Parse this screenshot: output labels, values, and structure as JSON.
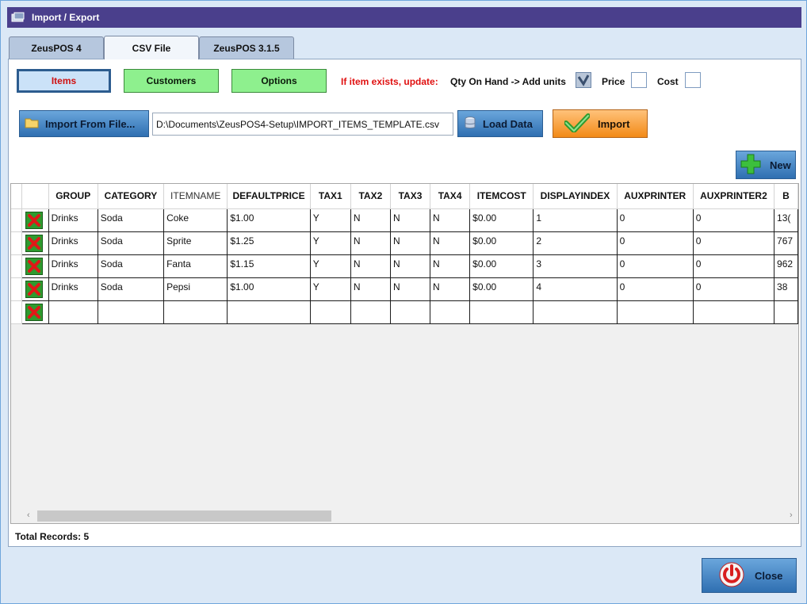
{
  "window": {
    "title": "Import / Export"
  },
  "tabs": [
    {
      "label": "ZeusPOS 4",
      "active": false
    },
    {
      "label": "CSV File",
      "active": true
    },
    {
      "label": "ZeusPOS 3.1.5",
      "active": false
    }
  ],
  "selectors": {
    "items": "Items",
    "customers": "Customers",
    "options": "Options"
  },
  "update_options": {
    "label": "If item exists, update:",
    "qty_label": "Qty On Hand -> Add units",
    "qty_checked": true,
    "price_label": "Price",
    "price_checked": false,
    "cost_label": "Cost",
    "cost_checked": false
  },
  "file": {
    "import_from_file_label": "Import From File...",
    "path": "D:\\Documents\\ZeusPOS4-Setup\\IMPORT_ITEMS_TEMPLATE.csv",
    "load_data_label": "Load Data",
    "import_label": "Import"
  },
  "new_label": "New",
  "grid": {
    "columns": [
      "GROUP",
      "CATEGORY",
      "ITEMNAME",
      "DEFAULTPRICE",
      "TAX1",
      "TAX2",
      "TAX3",
      "TAX4",
      "ITEMCOST",
      "DISPLAYINDEX",
      "AUXPRINTER",
      "AUXPRINTER2",
      "B"
    ],
    "rows": [
      [
        "Drinks",
        "Soda",
        "Coke",
        "$1.00",
        "Y",
        "N",
        "N",
        "N",
        "$0.00",
        "1",
        "0",
        "0",
        "13("
      ],
      [
        "Drinks",
        "Soda",
        "Sprite",
        "$1.25",
        "Y",
        "N",
        "N",
        "N",
        "$0.00",
        "2",
        "0",
        "0",
        "767"
      ],
      [
        "Drinks",
        "Soda",
        "Fanta",
        "$1.15",
        "Y",
        "N",
        "N",
        "N",
        "$0.00",
        "3",
        "0",
        "0",
        "962"
      ],
      [
        "Drinks",
        "Soda",
        "Pepsi",
        "$1.00",
        "Y",
        "N",
        "N",
        "N",
        "$0.00",
        "4",
        "0",
        "0",
        "38"
      ],
      [
        "",
        "",
        "",
        "",
        "",
        "",
        "",
        "",
        "",
        "",
        "",
        "",
        ""
      ]
    ]
  },
  "total_records": "Total Records: 5",
  "close_label": "Close",
  "colors": {
    "titlebar": "#4a3f8c",
    "items_text": "#d01010",
    "selector_green": "#8ef08e",
    "import_orange": "#f28a17",
    "blue_button": "#2f6fb1"
  }
}
